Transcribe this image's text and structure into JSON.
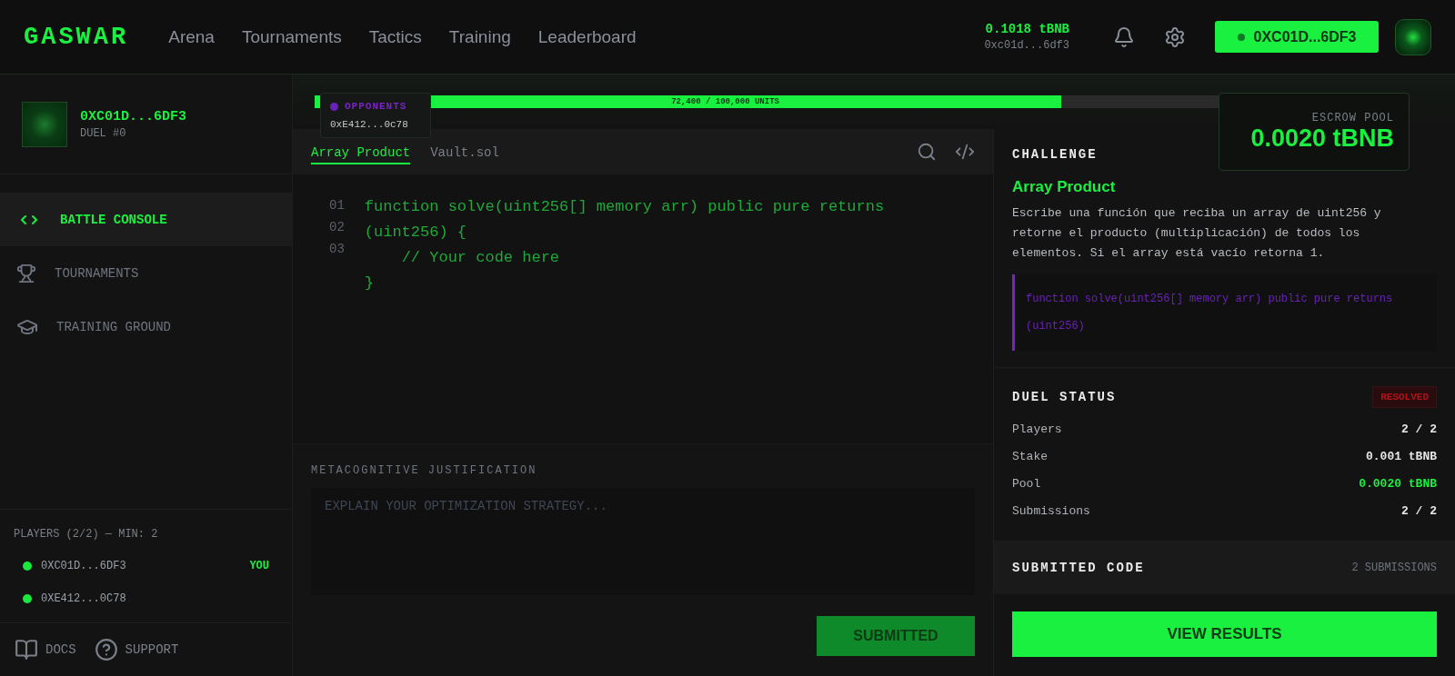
{
  "header": {
    "logo": "GASWAR",
    "nav": [
      {
        "label": "Arena",
        "selected": false
      },
      {
        "label": "Tournaments",
        "selected": false
      },
      {
        "label": "Tactics",
        "selected": false
      },
      {
        "label": "Training",
        "selected": false
      },
      {
        "label": "Leaderboard",
        "selected": false
      }
    ],
    "balance": "0.1018 tBNB",
    "address": "0xc01d...6df3",
    "wallet_button": "0XC01D...6DF3"
  },
  "sidebar": {
    "profile": {
      "name": "0XC01D...6DF3",
      "subtitle": "DUEL #0"
    },
    "items": [
      {
        "label": "BATTLE CONSOLE",
        "selected": true
      },
      {
        "label": "TOURNAMENTS",
        "selected": false
      },
      {
        "label": "TRAINING GROUND",
        "selected": false
      }
    ],
    "players": {
      "title": "PLAYERS (2/2) — MIN: 2",
      "list": [
        {
          "address": "0XC01D...6DF3",
          "tag": "YOU",
          "color": "#19e83c"
        },
        {
          "address": "0XE412...0C78",
          "color": "#19e83c"
        }
      ]
    },
    "footer": [
      "DOCS",
      "SUPPORT"
    ]
  },
  "gas": {
    "label": "72,400 / 100,000 UNITS",
    "level": 0.724
  },
  "opponents": {
    "title": "OPPONENTS",
    "address": "0xE412...0c78"
  },
  "escrow": {
    "label": "ESCROW POOL",
    "amount": "0.0020 tBNB"
  },
  "editor": {
    "tabs": [
      {
        "label": "Array Product",
        "selected": true
      },
      {
        "label": "Vault.sol",
        "selected": false
      }
    ],
    "line_numbers": [
      "01",
      "02",
      "03"
    ],
    "code": [
      "function solve(uint256[] memory arr) public pure returns (uint256) {",
      "    // Your code here",
      "}"
    ]
  },
  "justification": {
    "label": "METACOGNITIVE JUSTIFICATION",
    "placeholder": "EXPLAIN YOUR OPTIMIZATION STRATEGY..."
  },
  "submit_button": {
    "label": "SUBMITTED",
    "disabled": true
  },
  "challenge": {
    "heading": "CHALLENGE",
    "title": "Array Product",
    "description": "Escribe una función que reciba un array de uint256 y retorne el producto (multiplicación) de todos los elementos. Si el array está vacío retorna 1.",
    "signature": "function solve(uint256[] memory arr) public pure returns (uint256)"
  },
  "duel_status": {
    "heading": "DUEL STATUS",
    "badge": "RESOLVED",
    "rows": [
      {
        "label": "Players",
        "value": "2 / 2",
        "highlight": false
      },
      {
        "label": "Stake",
        "value": "0.001 tBNB",
        "highlight": false
      },
      {
        "label": "Pool",
        "value": "0.0020 tBNB",
        "highlight": true
      },
      {
        "label": "Submissions",
        "value": "2 / 2",
        "highlight": false
      }
    ]
  },
  "submitted_code": {
    "heading": "SUBMITTED CODE",
    "count": "2 SUBMISSIONS"
  },
  "view_button": "VIEW RESULTS"
}
